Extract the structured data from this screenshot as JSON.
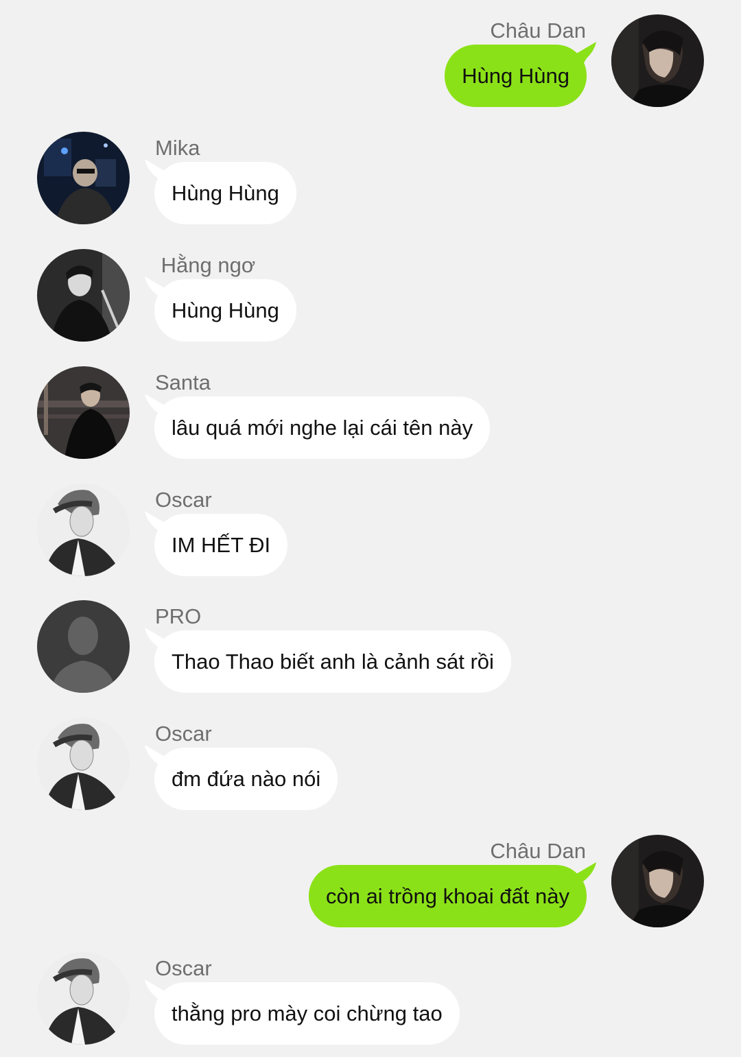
{
  "colors": {
    "background": "#f1f1f1",
    "incoming_bubble": "#ffffff",
    "outgoing_bubble": "#8be117",
    "sender_name": "#6e6e6e",
    "message_text": "#111111"
  },
  "messages": [
    {
      "direction": "out",
      "sender": "Châu Dan",
      "text": "Hùng Hùng",
      "avatar_icon": "profile-photo-chau-dan"
    },
    {
      "direction": "in",
      "sender": "Mika",
      "text": "Hùng Hùng",
      "avatar_icon": "profile-photo-mika"
    },
    {
      "direction": "in",
      "sender": " Hằng ngơ",
      "text": "Hùng Hùng",
      "avatar_icon": "profile-photo-hang-ngo"
    },
    {
      "direction": "in",
      "sender": "Santa",
      "text": "lâu quá mới nghe lại cái tên này",
      "avatar_icon": "profile-photo-santa"
    },
    {
      "direction": "in",
      "sender": "Oscar",
      "text": "IM HẾT ĐI",
      "avatar_icon": "profile-photo-oscar"
    },
    {
      "direction": "in",
      "sender": "PRO",
      "text": "Thao Thao biết anh là cảnh sát rồi",
      "avatar_icon": "default-person-silhouette-icon"
    },
    {
      "direction": "in",
      "sender": "Oscar",
      "text": "đm đứa nào nói",
      "avatar_icon": "profile-photo-oscar"
    },
    {
      "direction": "out",
      "sender": "Châu Dan",
      "text": "còn ai trồng khoai đất này",
      "avatar_icon": "profile-photo-chau-dan"
    },
    {
      "direction": "in",
      "sender": "Oscar",
      "text": "thằng pro mày coi chừng tao",
      "avatar_icon": "profile-photo-oscar"
    }
  ]
}
